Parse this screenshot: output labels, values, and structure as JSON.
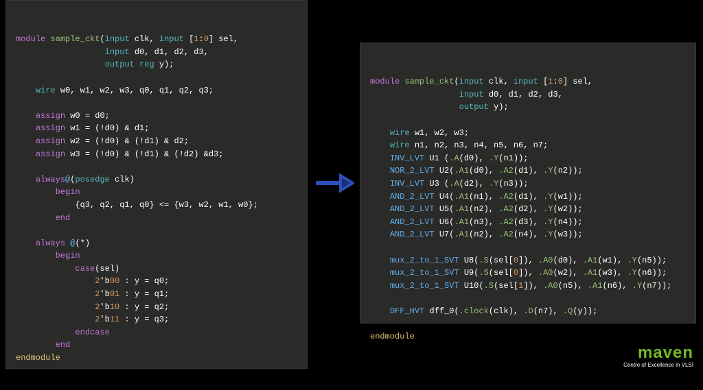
{
  "left_code_tokens": [
    [
      [
        "kw",
        "module"
      ],
      [
        "wh",
        " "
      ],
      [
        "fn",
        "sample_ckt"
      ],
      [
        "wh",
        "("
      ],
      [
        "cy",
        "input"
      ],
      [
        "wh",
        " clk, "
      ],
      [
        "cy",
        "input"
      ],
      [
        "wh",
        " ["
      ],
      [
        "num",
        "1"
      ],
      [
        "wh",
        ":"
      ],
      [
        "num",
        "0"
      ],
      [
        "wh",
        "] sel,"
      ]
    ],
    [
      [
        "wh",
        "                  "
      ],
      [
        "cy",
        "input"
      ],
      [
        "wh",
        " d0, d1, d2, d3,"
      ]
    ],
    [
      [
        "wh",
        "                  "
      ],
      [
        "cy",
        "output"
      ],
      [
        "wh",
        " "
      ],
      [
        "cy",
        "reg"
      ],
      [
        "wh",
        " y);"
      ]
    ],
    [
      [
        "wh",
        ""
      ]
    ],
    [
      [
        "wh",
        "    "
      ],
      [
        "cy",
        "wire"
      ],
      [
        "wh",
        " w0, w1, w2, w3, q0, q1, q2, q3;"
      ]
    ],
    [
      [
        "wh",
        ""
      ]
    ],
    [
      [
        "wh",
        "    "
      ],
      [
        "kw",
        "assign"
      ],
      [
        "wh",
        " w0 = d0;"
      ]
    ],
    [
      [
        "wh",
        "    "
      ],
      [
        "kw",
        "assign"
      ],
      [
        "wh",
        " w1 = (!d0) & d1;"
      ]
    ],
    [
      [
        "wh",
        "    "
      ],
      [
        "kw",
        "assign"
      ],
      [
        "wh",
        " w2 = (!d0) & (!d1) & d2;"
      ]
    ],
    [
      [
        "wh",
        "    "
      ],
      [
        "kw",
        "assign"
      ],
      [
        "wh",
        " w3 = (!d0) & (!d1) & (!d2) &d3;"
      ]
    ],
    [
      [
        "wh",
        ""
      ]
    ],
    [
      [
        "wh",
        "    "
      ],
      [
        "kw",
        "always"
      ],
      [
        "ty",
        "@"
      ],
      [
        "wh",
        "("
      ],
      [
        "cy",
        "posedge"
      ],
      [
        "wh",
        " clk)"
      ]
    ],
    [
      [
        "wh",
        "        "
      ],
      [
        "kw",
        "begin"
      ]
    ],
    [
      [
        "wh",
        "            {q3, q2, q1, q0} <= {w3, w2, w1, w0};"
      ]
    ],
    [
      [
        "wh",
        "        "
      ],
      [
        "kw",
        "end"
      ]
    ],
    [
      [
        "wh",
        ""
      ]
    ],
    [
      [
        "wh",
        "    "
      ],
      [
        "kw",
        "always"
      ],
      [
        "wh",
        " "
      ],
      [
        "ty",
        "@"
      ],
      [
        "wh",
        "(*)"
      ]
    ],
    [
      [
        "wh",
        "        "
      ],
      [
        "kw",
        "begin"
      ]
    ],
    [
      [
        "wh",
        "            "
      ],
      [
        "kw",
        "case"
      ],
      [
        "wh",
        "(sel)"
      ]
    ],
    [
      [
        "wh",
        "                "
      ],
      [
        "num",
        "2"
      ],
      [
        "wh",
        "'b"
      ],
      [
        "num",
        "00"
      ],
      [
        "wh",
        " : y = q0;"
      ]
    ],
    [
      [
        "wh",
        "                "
      ],
      [
        "num",
        "2"
      ],
      [
        "wh",
        "'b"
      ],
      [
        "num",
        "01"
      ],
      [
        "wh",
        " : y = q1;"
      ]
    ],
    [
      [
        "wh",
        "                "
      ],
      [
        "num",
        "2"
      ],
      [
        "wh",
        "'b"
      ],
      [
        "num",
        "10"
      ],
      [
        "wh",
        " : y = q2;"
      ]
    ],
    [
      [
        "wh",
        "                "
      ],
      [
        "num",
        "2"
      ],
      [
        "wh",
        "'b"
      ],
      [
        "num",
        "11"
      ],
      [
        "wh",
        " : y = q3;"
      ]
    ],
    [
      [
        "wh",
        "            "
      ],
      [
        "kw",
        "endcase"
      ]
    ],
    [
      [
        "wh",
        "        "
      ],
      [
        "kw",
        "end"
      ]
    ],
    [
      [
        "yl",
        "endmodule"
      ]
    ]
  ],
  "right_code_tokens": [
    [
      [
        "kw",
        "module"
      ],
      [
        "wh",
        " "
      ],
      [
        "fn",
        "sample_ckt"
      ],
      [
        "wh",
        "("
      ],
      [
        "cy",
        "input"
      ],
      [
        "wh",
        " clk, "
      ],
      [
        "cy",
        "input"
      ],
      [
        "wh",
        " ["
      ],
      [
        "num",
        "1"
      ],
      [
        "wh",
        ":"
      ],
      [
        "num",
        "0"
      ],
      [
        "wh",
        "] sel,"
      ]
    ],
    [
      [
        "wh",
        "                  "
      ],
      [
        "cy",
        "input"
      ],
      [
        "wh",
        " d0, d1, d2, d3,"
      ]
    ],
    [
      [
        "wh",
        "                  "
      ],
      [
        "cy",
        "output"
      ],
      [
        "wh",
        " y);"
      ]
    ],
    [
      [
        "wh",
        ""
      ]
    ],
    [
      [
        "wh",
        "    "
      ],
      [
        "cy",
        "wire"
      ],
      [
        "wh",
        " w1, w2, w3;"
      ]
    ],
    [
      [
        "wh",
        "    "
      ],
      [
        "cy",
        "wire"
      ],
      [
        "wh",
        " n1, n2, n3, n4, n5, n6, n7;"
      ]
    ],
    [
      [
        "wh",
        "    "
      ],
      [
        "ty",
        "INV_LVT"
      ],
      [
        "wh",
        " U1 ("
      ],
      [
        "fn",
        ".A"
      ],
      [
        "wh",
        "(d0), "
      ],
      [
        "fn",
        ".Y"
      ],
      [
        "wh",
        "(n1));"
      ]
    ],
    [
      [
        "wh",
        "    "
      ],
      [
        "ty",
        "NOR_2_LVT"
      ],
      [
        "wh",
        " U2("
      ],
      [
        "fn",
        ".A1"
      ],
      [
        "wh",
        "(d0), "
      ],
      [
        "fn",
        ".A2"
      ],
      [
        "wh",
        "(d1), "
      ],
      [
        "fn",
        ".Y"
      ],
      [
        "wh",
        "(n2));"
      ]
    ],
    [
      [
        "wh",
        "    "
      ],
      [
        "ty",
        "INV_LVT"
      ],
      [
        "wh",
        " U3 ("
      ],
      [
        "fn",
        ".A"
      ],
      [
        "wh",
        "(d2), "
      ],
      [
        "fn",
        ".Y"
      ],
      [
        "wh",
        "(n3));"
      ]
    ],
    [
      [
        "wh",
        "    "
      ],
      [
        "ty",
        "AND_2_LVT"
      ],
      [
        "wh",
        " U4("
      ],
      [
        "fn",
        ".A1"
      ],
      [
        "wh",
        "(n1), "
      ],
      [
        "fn",
        ".A2"
      ],
      [
        "wh",
        "(d1), "
      ],
      [
        "fn",
        ".Y"
      ],
      [
        "wh",
        "(w1));"
      ]
    ],
    [
      [
        "wh",
        "    "
      ],
      [
        "ty",
        "AND_2_LVT"
      ],
      [
        "wh",
        " U5("
      ],
      [
        "fn",
        ".A1"
      ],
      [
        "wh",
        "(n2), "
      ],
      [
        "fn",
        ".A2"
      ],
      [
        "wh",
        "(d2), "
      ],
      [
        "fn",
        ".Y"
      ],
      [
        "wh",
        "(w2));"
      ]
    ],
    [
      [
        "wh",
        "    "
      ],
      [
        "ty",
        "AND_2_LVT"
      ],
      [
        "wh",
        " U6("
      ],
      [
        "fn",
        ".A1"
      ],
      [
        "wh",
        "(n3), "
      ],
      [
        "fn",
        ".A2"
      ],
      [
        "wh",
        "(d3), "
      ],
      [
        "fn",
        ".Y"
      ],
      [
        "wh",
        "(n4));"
      ]
    ],
    [
      [
        "wh",
        "    "
      ],
      [
        "ty",
        "AND_2_LVT"
      ],
      [
        "wh",
        " U7("
      ],
      [
        "fn",
        ".A1"
      ],
      [
        "wh",
        "(n2), "
      ],
      [
        "fn",
        ".A2"
      ],
      [
        "wh",
        "(n4), "
      ],
      [
        "fn",
        ".Y"
      ],
      [
        "wh",
        "(w3));"
      ]
    ],
    [
      [
        "wh",
        ""
      ]
    ],
    [
      [
        "wh",
        "    "
      ],
      [
        "ty",
        "mux_2_to_1_SVT"
      ],
      [
        "wh",
        " U8("
      ],
      [
        "fn",
        ".S"
      ],
      [
        "wh",
        "(sel["
      ],
      [
        "num",
        "0"
      ],
      [
        "wh",
        "]), "
      ],
      [
        "fn",
        ".A0"
      ],
      [
        "wh",
        "(d0), "
      ],
      [
        "fn",
        ".A1"
      ],
      [
        "wh",
        "(w1), "
      ],
      [
        "fn",
        ".Y"
      ],
      [
        "wh",
        "(n5));"
      ]
    ],
    [
      [
        "wh",
        "    "
      ],
      [
        "ty",
        "mux_2_to_1_SVT"
      ],
      [
        "wh",
        " U9("
      ],
      [
        "fn",
        ".S"
      ],
      [
        "wh",
        "(sel["
      ],
      [
        "num",
        "0"
      ],
      [
        "wh",
        "]), "
      ],
      [
        "fn",
        ".A0"
      ],
      [
        "wh",
        "(w2), "
      ],
      [
        "fn",
        ".A1"
      ],
      [
        "wh",
        "(w3), "
      ],
      [
        "fn",
        ".Y"
      ],
      [
        "wh",
        "(n6));"
      ]
    ],
    [
      [
        "wh",
        "    "
      ],
      [
        "ty",
        "mux_2_to_1_SVT"
      ],
      [
        "wh",
        " U10("
      ],
      [
        "fn",
        ".S"
      ],
      [
        "wh",
        "(sel["
      ],
      [
        "num",
        "1"
      ],
      [
        "wh",
        "]), "
      ],
      [
        "fn",
        ".A0"
      ],
      [
        "wh",
        "(n5), "
      ],
      [
        "fn",
        ".A1"
      ],
      [
        "wh",
        "(n6), "
      ],
      [
        "fn",
        ".Y"
      ],
      [
        "wh",
        "(n7));"
      ]
    ],
    [
      [
        "wh",
        ""
      ]
    ],
    [
      [
        "wh",
        "    "
      ],
      [
        "ty",
        "DFF_HVT"
      ],
      [
        "wh",
        " dff_0("
      ],
      [
        "fn",
        ".clock"
      ],
      [
        "wh",
        "(clk), "
      ],
      [
        "fn",
        ".D"
      ],
      [
        "wh",
        "(n7), "
      ],
      [
        "fn",
        ".Q"
      ],
      [
        "wh",
        "(y));"
      ]
    ],
    [
      [
        "wh",
        ""
      ]
    ],
    [
      [
        "yl",
        "endmodule"
      ]
    ]
  ],
  "logo": {
    "main": "maven",
    "sub": "Centre of Excellence in VLSI"
  }
}
